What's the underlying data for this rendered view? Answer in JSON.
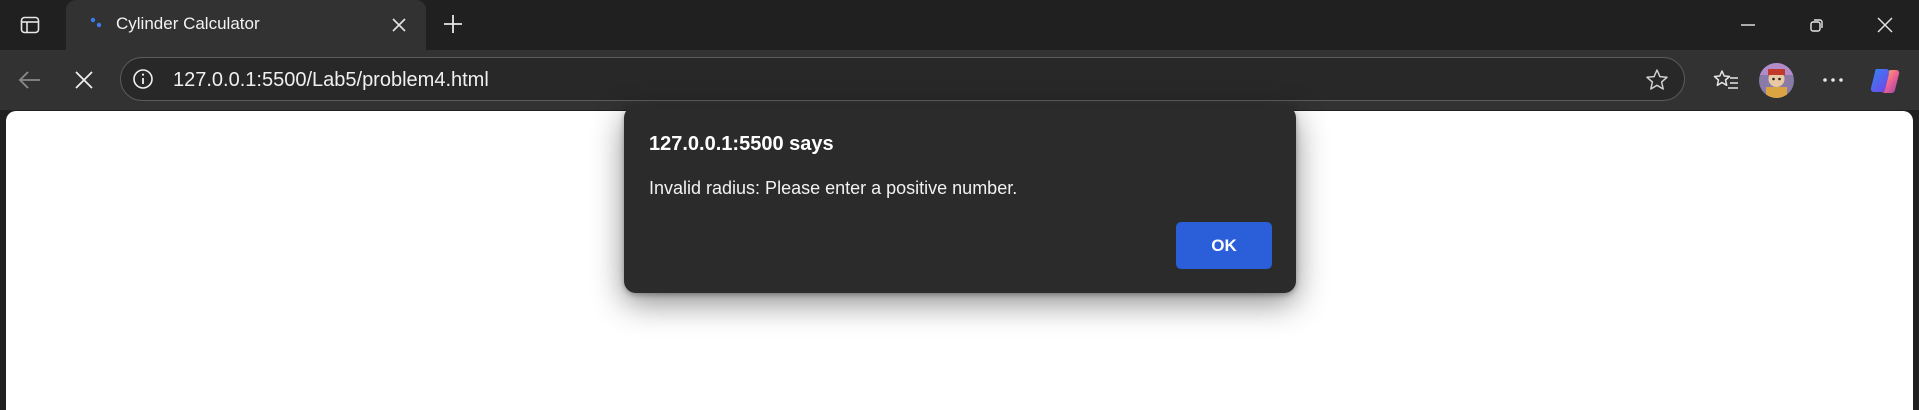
{
  "browser": {
    "tab": {
      "title": "Cylinder Calculator",
      "favicon": "loading-dots-icon"
    },
    "address_bar": {
      "url": "127.0.0.1:5500/Lab5/problem4.html"
    },
    "icons": {
      "sidebar": "sidebar-icon",
      "tab_close": "close-icon",
      "new_tab": "plus-icon",
      "minimize": "minimize-icon",
      "restore": "restore-icon",
      "window_close": "close-icon",
      "back": "back-arrow-icon",
      "stop": "stop-icon",
      "site_info": "info-icon",
      "favorite": "star-icon",
      "favorites": "favorites-icon",
      "more": "more-icon",
      "copilot": "copilot-icon"
    }
  },
  "dialog": {
    "title": "127.0.0.1:5500 says",
    "message": "Invalid radius: Please enter a positive number.",
    "ok_label": "OK"
  },
  "colors": {
    "chrome": "#202020",
    "toolbar": "#323232",
    "dialog": "#2b2b2b",
    "accent": "#2b5fd9"
  }
}
